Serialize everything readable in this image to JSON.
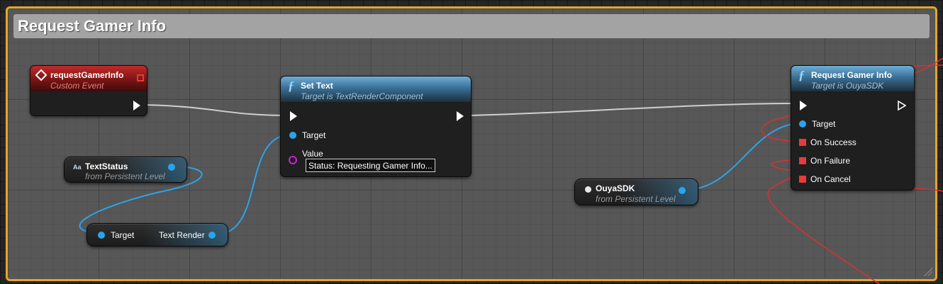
{
  "comment": {
    "title": "Request Gamer Info",
    "border_color": "#e7a529",
    "header_color": "#a3a3a3"
  },
  "event_node": {
    "title": "requestGamerInfo",
    "subtitle": "Custom Event",
    "icon": "custom-event-icon",
    "color": "#a31e1e"
  },
  "set_text_node": {
    "title": "Set Text",
    "subtitle": "Target is TextRenderComponent",
    "icon": "function-icon",
    "pins": {
      "target_label": "Target",
      "value_label": "Value",
      "value_text": "Status: Requesting Gamer Info..."
    }
  },
  "request_node": {
    "title": "Request Gamer Info",
    "subtitle": "Target is OuyaSDK",
    "icon": "function-icon",
    "pins": {
      "target_label": "Target",
      "on_success_label": "On Success",
      "on_failure_label": "On Failure",
      "on_cancel_label": "On Cancel"
    }
  },
  "text_status_node": {
    "name": "TextStatus",
    "source": "from Persistent Level",
    "type_icon_text": "Aa"
  },
  "text_render_node": {
    "input_label": "Target",
    "output_label": "Text Render"
  },
  "ouya_node": {
    "name": "OuyaSDK",
    "source": "from Persistent Level"
  },
  "colors": {
    "object_pin": "#2aa3ee",
    "text_pin": "#d21fd8",
    "delegate_pin": "#e53b3b",
    "exec_wire": "#cfcfcf"
  }
}
